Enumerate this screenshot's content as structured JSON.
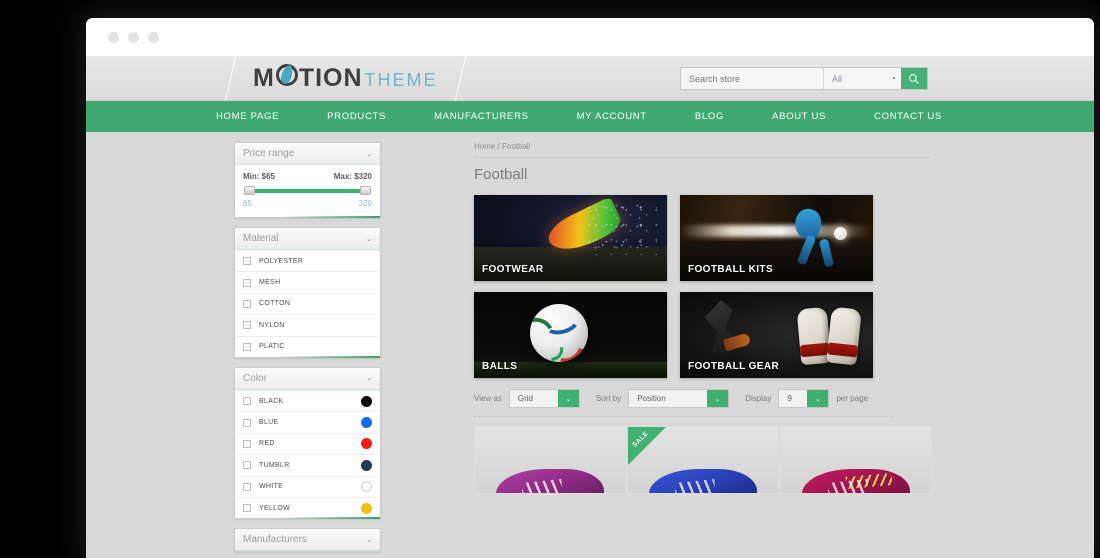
{
  "window": {
    "dots": [
      "dot-1",
      "dot-2",
      "dot-3"
    ]
  },
  "header": {
    "logo": {
      "part1": "M",
      "part2": "TION",
      "part3": "THEME"
    },
    "search": {
      "placeholder": "Search store",
      "value": "",
      "category": "All",
      "caret": "▼",
      "button_icon": "search-icon"
    }
  },
  "nav": {
    "items": [
      {
        "label": "HOME PAGE"
      },
      {
        "label": "PRODUCTS"
      },
      {
        "label": "MANUFACTURERS"
      },
      {
        "label": "MY ACCOUNT"
      },
      {
        "label": "BLOG"
      },
      {
        "label": "ABOUT US"
      },
      {
        "label": "CONTACT US"
      }
    ]
  },
  "sidebar": {
    "price_panel": {
      "title": "Price range",
      "chevron": "⌄",
      "min_label": "Min: $65",
      "max_label": "Max: $320",
      "scale_min": "65",
      "scale_max": "320"
    },
    "material_panel": {
      "title": "Material",
      "chevron": "⌄",
      "options": [
        {
          "label": "POLYESTER",
          "checked": false
        },
        {
          "label": "MESH",
          "checked": false
        },
        {
          "label": "COTTON",
          "checked": false
        },
        {
          "label": "NYLON",
          "checked": false
        },
        {
          "label": "PLATIC",
          "checked": false
        }
      ]
    },
    "color_panel": {
      "title": "Color",
      "chevron": "⌄",
      "options": [
        {
          "label": "BLACK",
          "color": "#0a0a0a",
          "checked": false
        },
        {
          "label": "BLUE",
          "color": "#1769e8",
          "checked": false
        },
        {
          "label": "RED",
          "color": "#ec1c16",
          "checked": false
        },
        {
          "label": "TUMBLR",
          "color": "#243a52",
          "checked": false
        },
        {
          "label": "WHITE",
          "color": "#ffffff",
          "checked": false
        },
        {
          "label": "YELLOW",
          "color": "#f1c016",
          "checked": false
        }
      ]
    },
    "manufacturers_panel": {
      "title": "Manufacturers",
      "chevron": "⌄"
    }
  },
  "content": {
    "breadcrumb": "Home / Football",
    "page_title": "Football",
    "tiles": [
      {
        "label": "FOOTWEAR"
      },
      {
        "label": "FOOTBALL KITS"
      },
      {
        "label": "BALLS"
      },
      {
        "label": "FOOTBALL GEAR"
      }
    ],
    "toolbar": {
      "view_as_label": "View as",
      "view_as_value": "Grid",
      "sort_by_label": "Sort by",
      "sort_by_value": "Position",
      "display_label": "Display",
      "display_value": "9",
      "per_page_label": "per page",
      "arrow": "⌄"
    },
    "products": [
      {
        "name": "product-purple",
        "sale": false,
        "badge": ""
      },
      {
        "name": "product-blue",
        "sale": true,
        "badge": "SALE"
      },
      {
        "name": "product-pink",
        "sale": false,
        "badge": ""
      }
    ]
  },
  "colors": {
    "brand_green": "#3fa971",
    "accent_green": "#3fb070",
    "logo_teal": "#6fb3c9",
    "page_bg": "#d9d9d9"
  }
}
